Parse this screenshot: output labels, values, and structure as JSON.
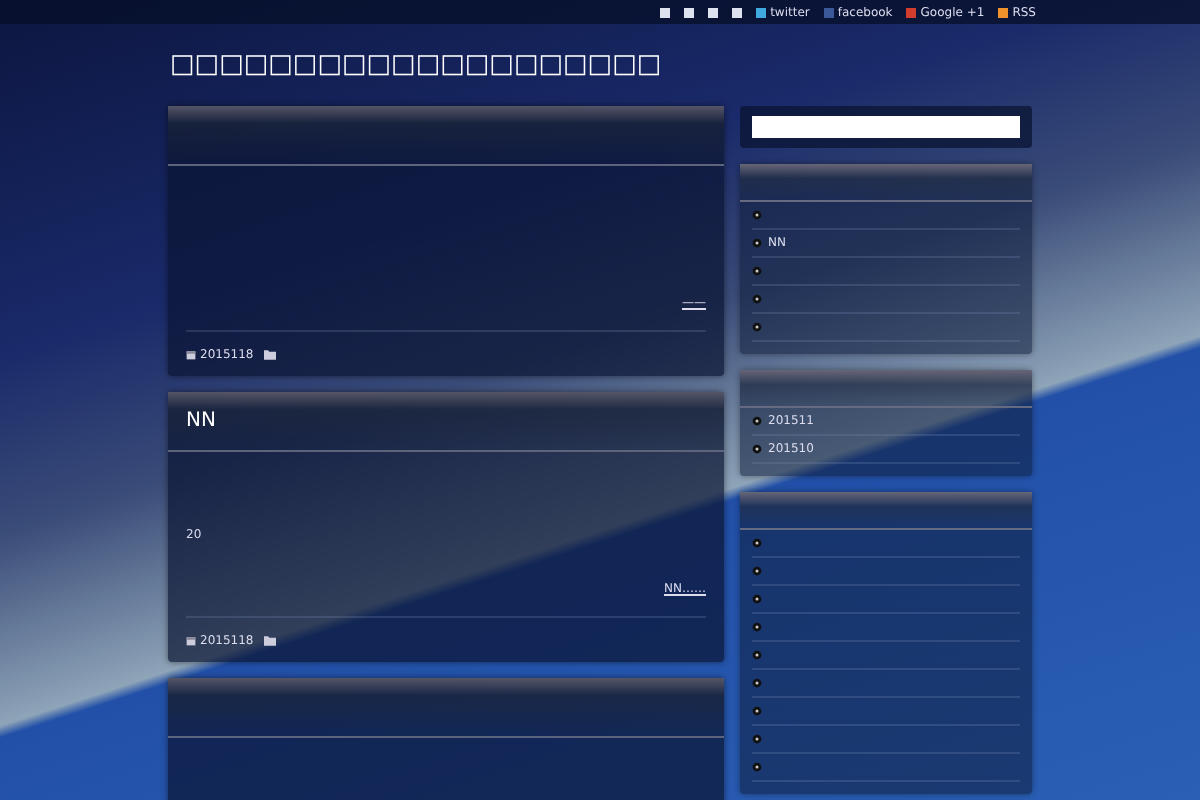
{
  "top_bar": {
    "links": [
      {
        "kind": "icon"
      },
      {
        "kind": "icon"
      },
      {
        "kind": "icon"
      },
      {
        "kind": "icon"
      },
      {
        "kind": "twitter",
        "label": "twitter"
      },
      {
        "kind": "facebook",
        "label": "facebook"
      },
      {
        "kind": "google",
        "label": "Google +1"
      },
      {
        "kind": "rss",
        "label": "RSS"
      }
    ]
  },
  "site_title": "□□□□□□□□□□□□□□□□□□□□",
  "posts": [
    {
      "kind": "full",
      "more_link": "——",
      "date": "2015118"
    },
    {
      "kind": "full",
      "title": "NN",
      "excerpt": "20",
      "more_link": "NN……",
      "date": "2015118"
    },
    {
      "kind": "cut"
    }
  ],
  "sidebar": {
    "widgets": [
      {
        "items": [
          {
            "kind": "bullet"
          },
          {
            "kind": "link",
            "label": "NN"
          },
          {
            "kind": "bullet"
          },
          {
            "kind": "bullet"
          },
          {
            "kind": "bullet"
          }
        ]
      },
      {
        "items": [
          {
            "kind": "link",
            "label": "201511"
          },
          {
            "kind": "link",
            "label": "201510"
          }
        ]
      },
      {
        "items": [
          {
            "kind": "bullet"
          },
          {
            "kind": "bullet"
          },
          {
            "kind": "bullet"
          },
          {
            "kind": "bullet"
          },
          {
            "kind": "bullet"
          },
          {
            "kind": "bullet"
          },
          {
            "kind": "bullet"
          },
          {
            "kind": "bullet"
          },
          {
            "kind": "bullet"
          }
        ]
      }
    ]
  }
}
